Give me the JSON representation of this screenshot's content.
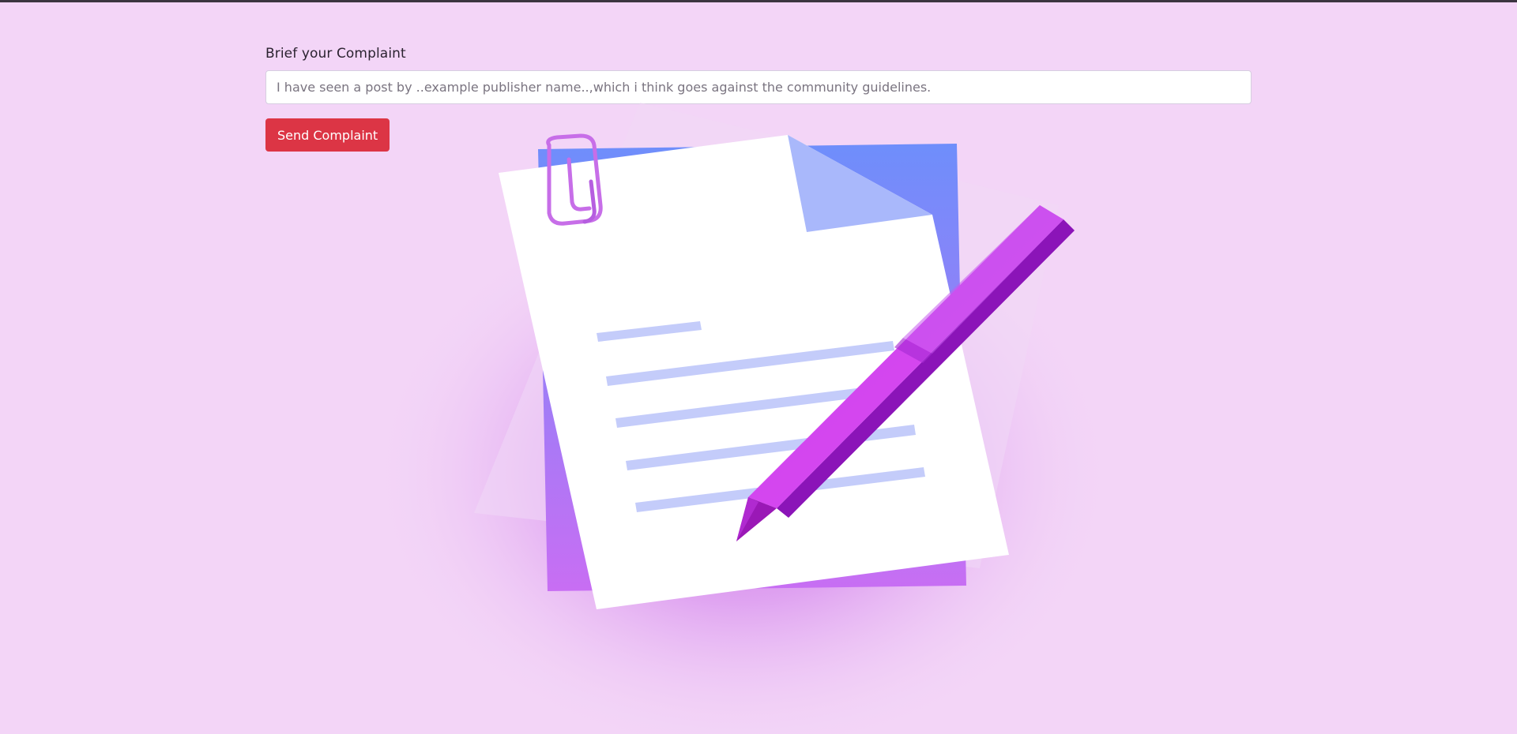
{
  "form": {
    "label": "Brief your Complaint",
    "placeholder": "I have seen a post by ..example publisher name..,which i think goes against the community guidelines.",
    "value": ""
  },
  "actions": {
    "send_label": "Send Complaint"
  },
  "colors": {
    "background": "#f3d5f7",
    "button": "#dc3545",
    "accent_purple": "#d63cf0",
    "accent_blue": "#6f8dfb"
  },
  "illustration": {
    "icon": "document-with-pen-icon"
  }
}
